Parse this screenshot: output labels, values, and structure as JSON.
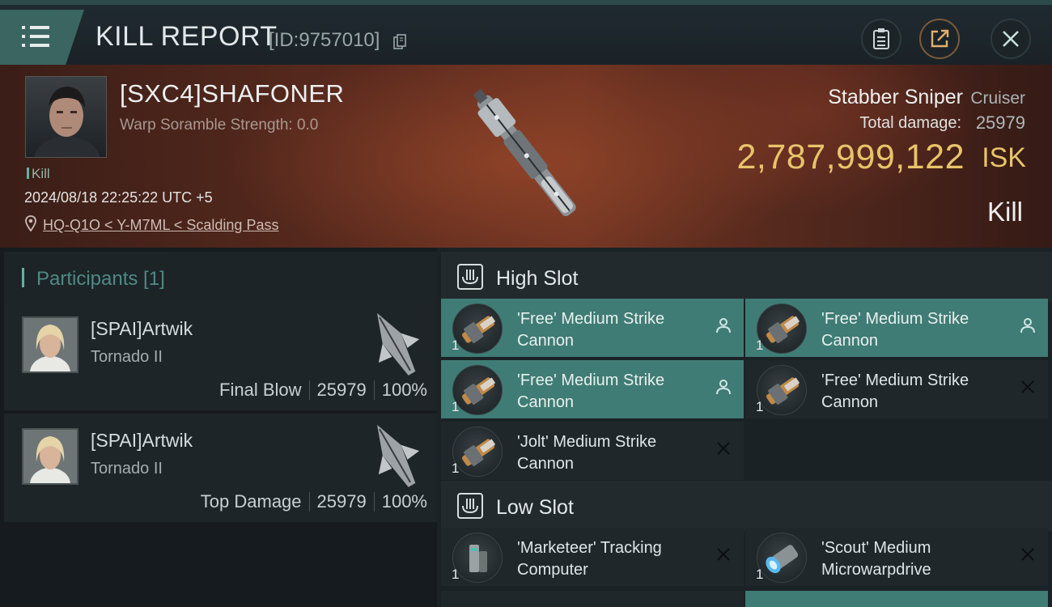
{
  "header": {
    "title": "KILL REPORT",
    "id_text": "[ID:9757010]"
  },
  "victim": {
    "name": "[SXC4]SHAFONER",
    "warp_scramble": "Warp Soramble Strength: 0.0",
    "tag": "Kill",
    "datetime": "2024/08/18 22:25:22 UTC +5",
    "location": "HQ-Q1O < Y-M7ML < Scalding Pass",
    "ship_name": "Stabber Sniper",
    "ship_class": "Cruiser",
    "damage_label": "Total damage:",
    "damage_value": "25979",
    "isk_value": "2,787,999,122",
    "isk_unit": "ISK",
    "result": "Kill"
  },
  "participants": {
    "title": "Participants [1]",
    "items": [
      {
        "name": "[SPAI]Artwik",
        "ship": "Tornado II",
        "role": "Final Blow",
        "damage": "25979",
        "percent": "100%"
      },
      {
        "name": "[SPAI]Artwik",
        "ship": "Tornado II",
        "role": "Top Damage",
        "damage": "25979",
        "percent": "100%"
      }
    ]
  },
  "fitting": {
    "high_slot": {
      "title": "High Slot",
      "modules": [
        {
          "name": "'Free' Medium Strike Cannon",
          "qty": "1",
          "state": "active"
        },
        {
          "name": "'Free' Medium Strike Cannon",
          "qty": "1",
          "state": "active"
        },
        {
          "name": "'Free' Medium Strike Cannon",
          "qty": "1",
          "state": "active"
        },
        {
          "name": "'Free' Medium Strike Cannon",
          "qty": "1",
          "state": "destroyed"
        },
        {
          "name": "'Jolt' Medium Strike Cannon",
          "qty": "1",
          "state": "destroyed"
        }
      ]
    },
    "low_slot": {
      "title": "Low Slot",
      "modules": [
        {
          "name": "'Marketeer' Tracking Computer",
          "qty": "1",
          "state": "destroyed"
        },
        {
          "name": "'Scout' Medium Microwarpdrive",
          "qty": "1",
          "state": "destroyed"
        }
      ]
    }
  }
}
